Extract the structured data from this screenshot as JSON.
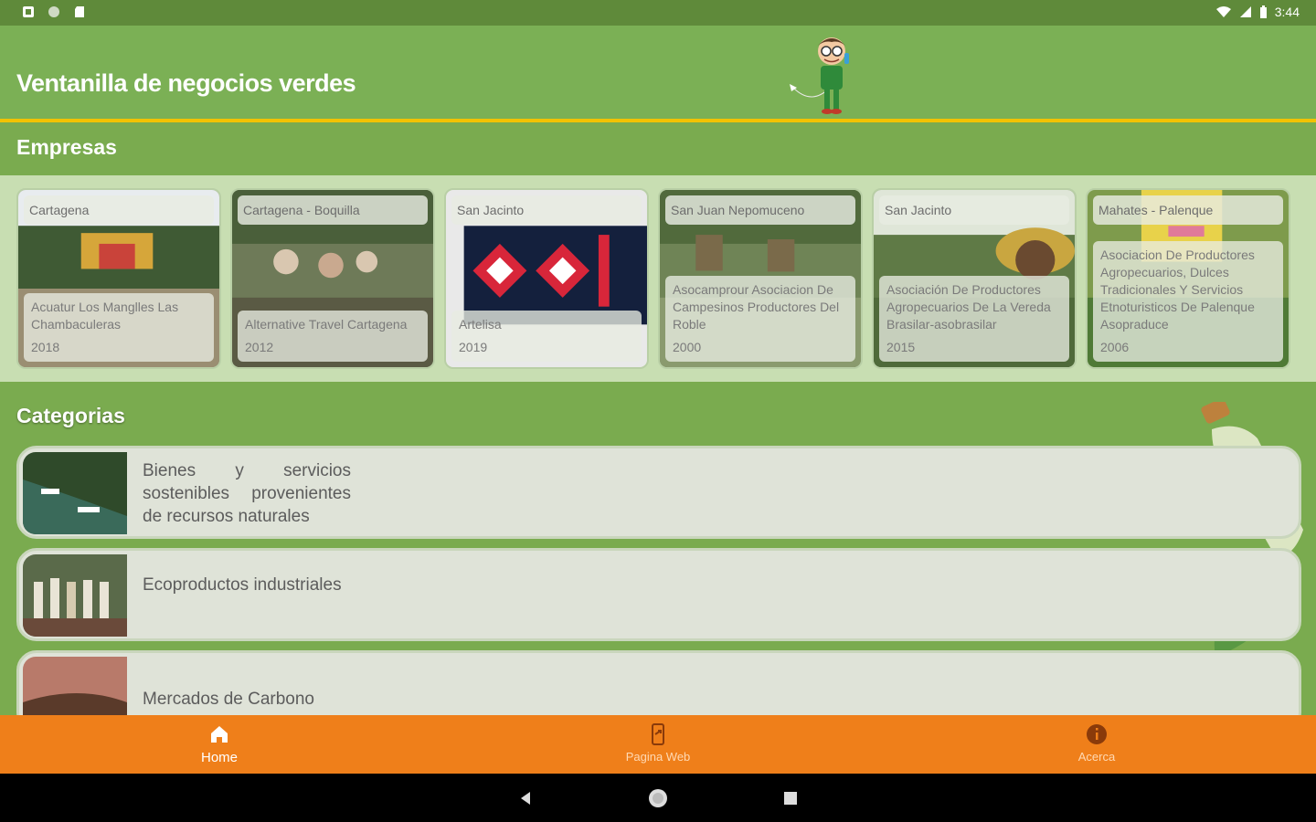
{
  "status_bar": {
    "time": "3:44"
  },
  "app_bar": {
    "title": "Ventanilla de negocios verdes"
  },
  "empresas": {
    "title": "Empresas",
    "cards": [
      {
        "city": "Cartagena",
        "name": "Acuatur Los Manglles Las Chambaculeras",
        "year": "2018"
      },
      {
        "city": "Cartagena - Boquilla",
        "name": "Alternative Travel Cartagena",
        "year": "2012"
      },
      {
        "city": "San Jacinto",
        "name": "Artelisa",
        "year": "2019"
      },
      {
        "city": "San Juan Nepomuceno",
        "name": "Asocamprour Asociacion De Campesinos Productores Del Roble",
        "year": "2000"
      },
      {
        "city": "San Jacinto",
        "name": "Asociación De Productores Agropecuarios De La Vereda Brasilar-asobrasilar",
        "year": "2015"
      },
      {
        "city": "Mahates - Palenque",
        "name": "Asociacion De Productores Agropecuarios, Dulces Tradicionales Y Servicios Etnoturisticos De Palenque Asopraduce",
        "year": "2006"
      }
    ]
  },
  "categorias": {
    "title": "Categorias",
    "items": [
      {
        "label": "Bienes y servicios sostenibles provenientes de recursos naturales"
      },
      {
        "label": "Ecoproductos industriales"
      },
      {
        "label": "Mercados de Carbono"
      }
    ]
  },
  "bottom_nav": {
    "items": [
      {
        "label": "Home",
        "icon": "home-icon",
        "active": true
      },
      {
        "label": "Pagina Web",
        "icon": "phone-link-icon",
        "active": false
      },
      {
        "label": "Acerca",
        "icon": "info-icon",
        "active": false
      }
    ]
  },
  "colors": {
    "app_bar": "#7bb055",
    "accent_line": "#f2c200",
    "bottom_nav": "#ef7f1a"
  }
}
